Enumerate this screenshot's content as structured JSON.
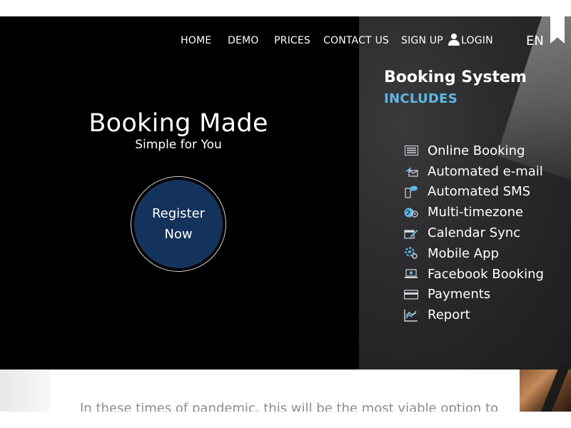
{
  "nav": {
    "items": [
      "HOME",
      "DEMO",
      "PRICES",
      "CONTACT US",
      "SIGN UP"
    ],
    "login": "LOGIN",
    "language": "EN"
  },
  "hero": {
    "title": "Booking Made",
    "subtitle": "Simple for You",
    "register_line1": "Register",
    "register_line2": "Now"
  },
  "features": {
    "title": "Booking System",
    "subtitle": "INCLUDES",
    "items": [
      {
        "label": "Online Booking",
        "icon": "list-icon"
      },
      {
        "label": "Automated e-mail",
        "icon": "email-icon"
      },
      {
        "label": "Automated SMS",
        "icon": "sms-icon"
      },
      {
        "label": "Multi-timezone",
        "icon": "globe-icon"
      },
      {
        "label": "Calendar Sync",
        "icon": "calendar-sync-icon"
      },
      {
        "label": "Mobile App",
        "icon": "mobile-app-icon"
      },
      {
        "label": "Facebook Booking",
        "icon": "laptop-icon"
      },
      {
        "label": "Payments",
        "icon": "credit-card-icon"
      },
      {
        "label": "Report",
        "icon": "chart-icon"
      }
    ]
  },
  "content": {
    "intro": "In these times of pandemic, this will be the most viable option to"
  },
  "colors": {
    "accent_blue": "#5fb7e6",
    "button_navy": "#14335c",
    "hero_bg": "#000000"
  }
}
